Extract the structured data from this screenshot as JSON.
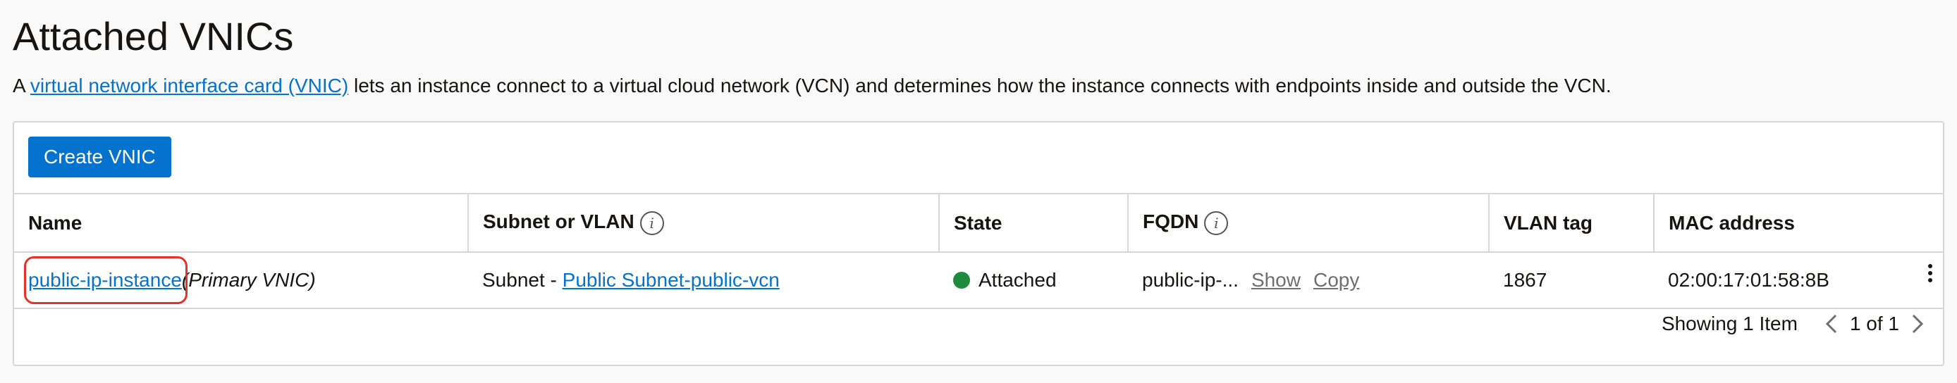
{
  "header": {
    "title": "Attached VNICs",
    "desc_prefix": "A ",
    "desc_link": "virtual network interface card (VNIC)",
    "desc_suffix": " lets an instance connect to a virtual cloud network (VCN) and determines how the instance connects with endpoints inside and outside the VCN."
  },
  "toolbar": {
    "create_label": "Create VNIC"
  },
  "table": {
    "columns": {
      "name": "Name",
      "subnet": "Subnet or VLAN",
      "state": "State",
      "fqdn": "FQDN",
      "vlan_tag": "VLAN tag",
      "mac": "MAC address"
    },
    "rows": [
      {
        "name": "public-ip-instance",
        "name_suffix": "(Primary VNIC)",
        "subnet_prefix": "Subnet - ",
        "subnet_link": "Public Subnet-public-vcn",
        "state": "Attached",
        "fqdn": "public-ip-...",
        "fqdn_show": "Show",
        "fqdn_copy": "Copy",
        "vlan_tag": "1867",
        "mac": "02:00:17:01:58:8B"
      }
    ]
  },
  "pagination": {
    "showing": "Showing 1 Item",
    "pages": "1 of 1"
  },
  "icons": {
    "info": "i",
    "state_color": "#1e8b3c",
    "accent": "#0572ce",
    "highlight": "#e5322b"
  }
}
